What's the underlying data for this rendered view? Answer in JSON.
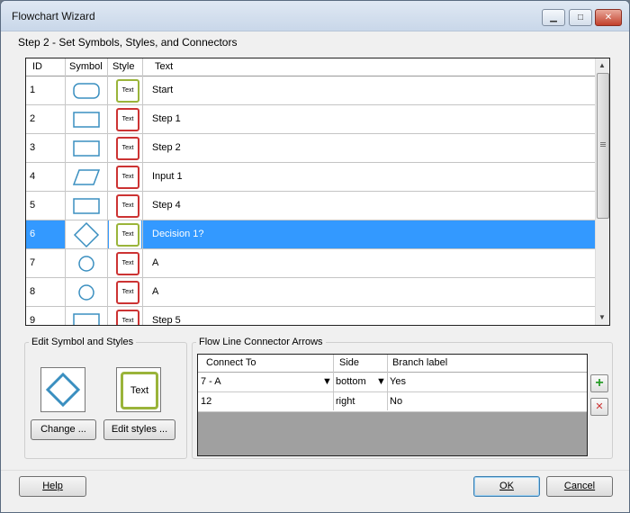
{
  "window": {
    "title": "Flowchart Wizard",
    "minimize": "▁",
    "maximize": "□",
    "close": "✕"
  },
  "step_title": "Step 2 - Set Symbols, Styles, and Connectors",
  "grid": {
    "columns": [
      "ID",
      "Symbol",
      "Style",
      "Text"
    ],
    "rows": [
      {
        "id": "1",
        "symbol": "rounded-rectangle",
        "style": "green",
        "style_label": "Text",
        "text": "Start"
      },
      {
        "id": "2",
        "symbol": "rectangle",
        "style": "red",
        "style_label": "Text",
        "text": "Step 1"
      },
      {
        "id": "3",
        "symbol": "rectangle",
        "style": "red",
        "style_label": "Text",
        "text": "Step 2"
      },
      {
        "id": "4",
        "symbol": "parallelogram",
        "style": "red",
        "style_label": "Text",
        "text": "Input 1"
      },
      {
        "id": "5",
        "symbol": "rectangle",
        "style": "red",
        "style_label": "Text",
        "text": "Step 4"
      },
      {
        "id": "6",
        "symbol": "diamond",
        "style": "green",
        "style_label": "Text",
        "text": "Decision 1?",
        "selected": true
      },
      {
        "id": "7",
        "symbol": "circle",
        "style": "red",
        "style_label": "Text",
        "text": "A"
      },
      {
        "id": "8",
        "symbol": "circle",
        "style": "red",
        "style_label": "Text",
        "text": "A"
      },
      {
        "id": "9",
        "symbol": "rectangle",
        "style": "red",
        "style_label": "Text",
        "text": "Step 5"
      }
    ]
  },
  "edit_panel": {
    "legend": "Edit Symbol and Styles",
    "style_preview_label": "Text",
    "change_button": "Change ...",
    "edit_styles_button": "Edit styles ..."
  },
  "connector_panel": {
    "legend": "Flow Line Connector Arrows",
    "columns": [
      "Connect To",
      "Side",
      "Branch label"
    ],
    "rows": [
      {
        "connect_to": "7 - A",
        "side": "bottom",
        "branch": "Yes"
      },
      {
        "connect_to": "12",
        "side": "right",
        "branch": "No"
      }
    ],
    "add": "+",
    "delete": "✕"
  },
  "footer": {
    "help": "Help",
    "ok": "OK",
    "cancel": "Cancel"
  },
  "colors": {
    "selection": "#3399ff",
    "symbol_stroke": "#3a8fc0",
    "style_green": "#9ab43a",
    "style_red": "#cc3333"
  }
}
